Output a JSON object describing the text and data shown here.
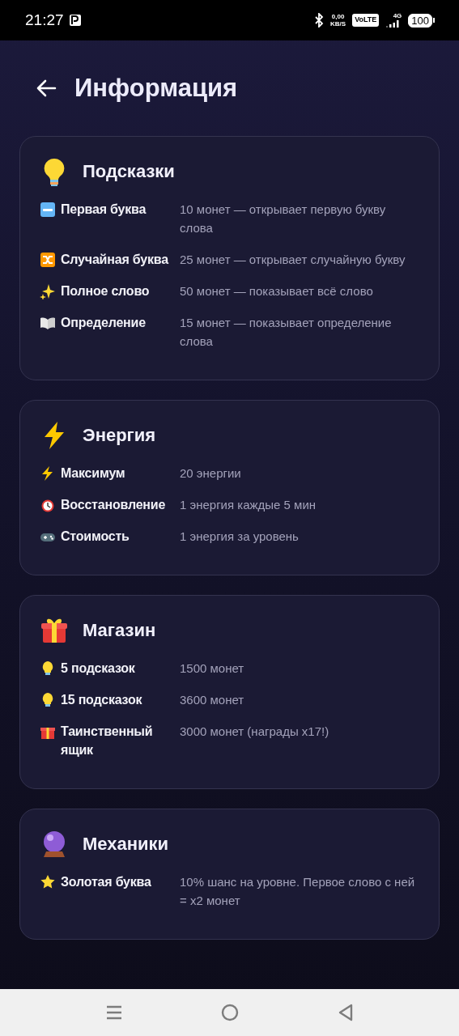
{
  "status_bar": {
    "time": "21:27",
    "net_speed": "0,00",
    "net_unit": "KB/S",
    "volte": "VoLTE",
    "network": "4G",
    "battery": "100"
  },
  "header": {
    "title": "Информация"
  },
  "sections": [
    {
      "title": "Подсказки",
      "rows": [
        {
          "label": "Первая буква",
          "value": "10 монет — открывает первую букву слова"
        },
        {
          "label": "Случайная буква",
          "value": "25 монет — открывает случайную букву"
        },
        {
          "label": "Полное слово",
          "value": "50 монет — показывает всё слово"
        },
        {
          "label": "Определение",
          "value": "15 монет — показывает определение слова"
        }
      ]
    },
    {
      "title": "Энергия",
      "rows": [
        {
          "label": "Максимум",
          "value": "20 энергии"
        },
        {
          "label": "Восстановление",
          "value": "1 энергия каждые 5 мин"
        },
        {
          "label": "Стоимость",
          "value": "1 энергия за уровень"
        }
      ]
    },
    {
      "title": "Магазин",
      "rows": [
        {
          "label": "5 подсказок",
          "value": "1500 монет"
        },
        {
          "label": "15 подсказок",
          "value": "3600 монет"
        },
        {
          "label": "Таинственный ящик",
          "value": "3000 монет (награды x17!)"
        }
      ]
    },
    {
      "title": "Механики",
      "rows": [
        {
          "label": "Золотая буква",
          "value": "10% шанс на уровне. Первое слово с ней = x2 монет"
        }
      ]
    }
  ]
}
